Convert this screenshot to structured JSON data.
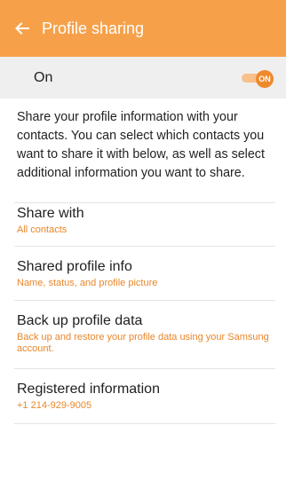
{
  "appbar": {
    "title": "Profile sharing"
  },
  "master_switch": {
    "label": "On",
    "toggle_text": "ON",
    "state": "on"
  },
  "description": "Share your profile information with your contacts. You can select which contacts you want to share it with below, as well as select additional information you want to share.",
  "items": [
    {
      "title": "Share with",
      "subtitle": "All contacts"
    },
    {
      "title": "Shared profile info",
      "subtitle": "Name, status, and profile picture"
    },
    {
      "title": "Back up profile data",
      "subtitle": "Back up and restore your profile data using your Samsung account."
    },
    {
      "title": "Registered information",
      "subtitle": "+1 214-929-9005"
    }
  ],
  "colors": {
    "accent": "#f6a14a",
    "subtitle": "#e8862a",
    "toggle": "#ee8a2c"
  },
  "icons": {
    "back": "arrow-left"
  }
}
